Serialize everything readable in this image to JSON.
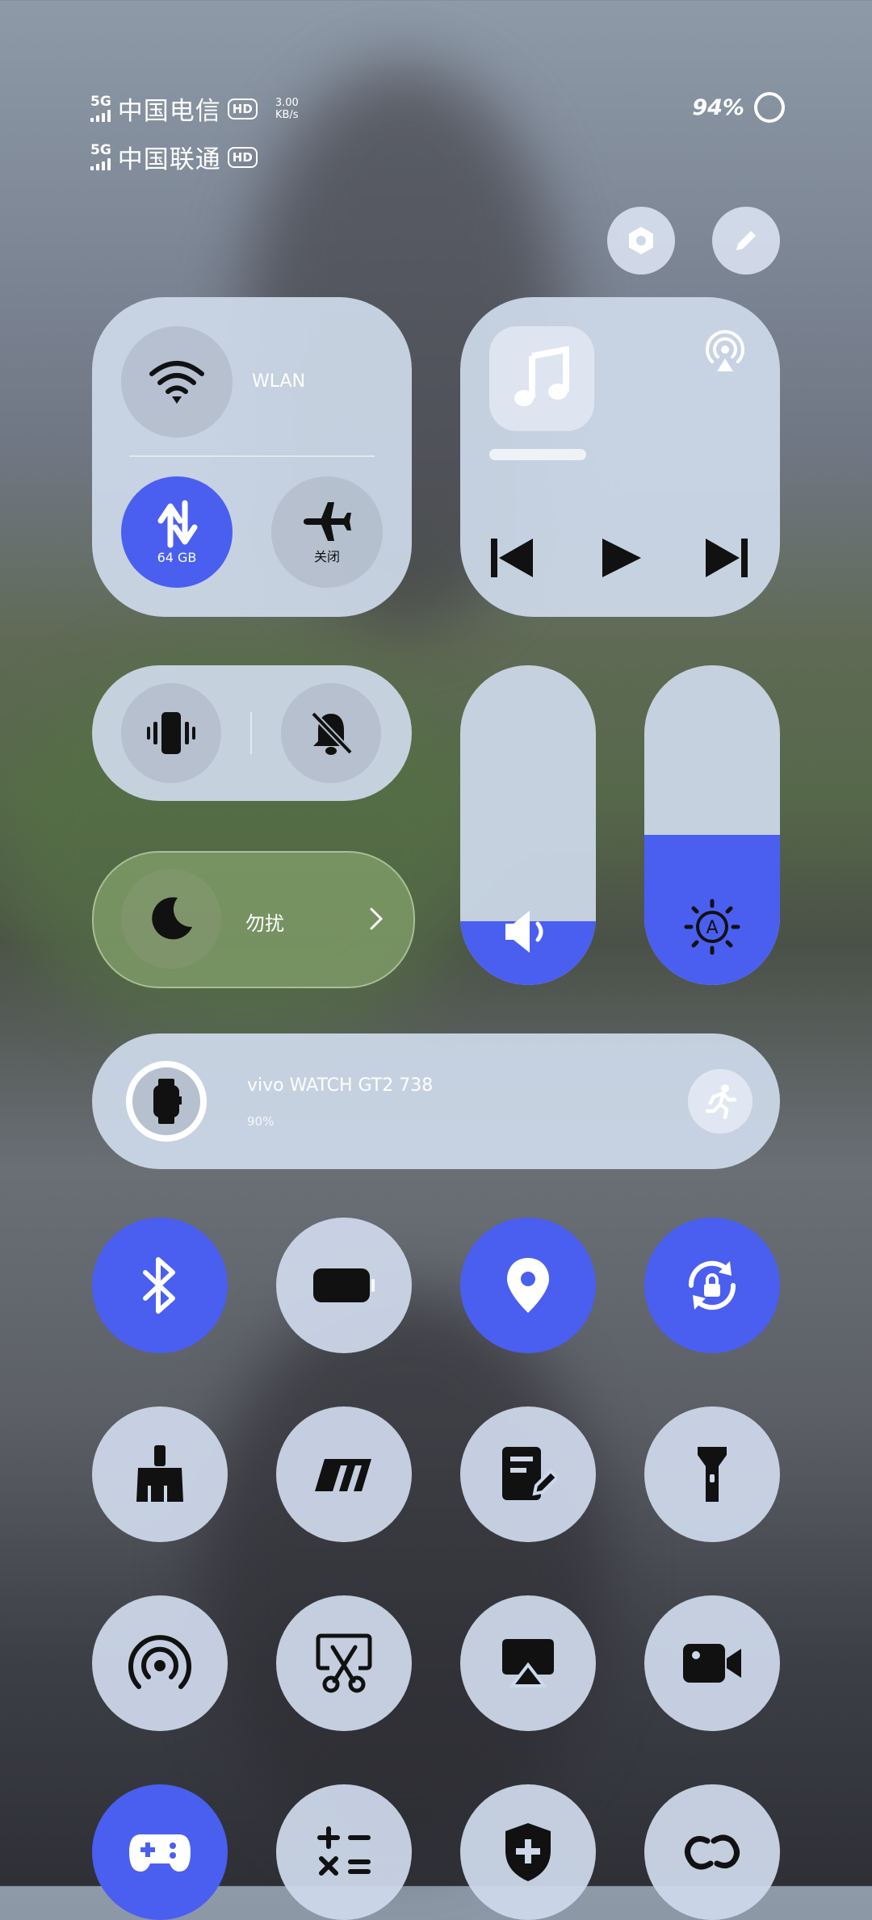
{
  "status_bar": {
    "carrier1": {
      "network": "5G",
      "name": "中国电信",
      "hd": "HD",
      "speed_value": "3.00",
      "speed_unit": "KB/s"
    },
    "carrier2": {
      "network": "5G",
      "name": "中国联通",
      "hd": "HD"
    },
    "battery_percent": "94%"
  },
  "connectivity": {
    "wifi_label": "WLAN",
    "data_usage": "64 GB",
    "airplane_label": "关闭"
  },
  "sound_modes": {},
  "dnd": {
    "label": "勿扰"
  },
  "sliders": {
    "volume_level": 0.2,
    "brightness_level": 0.47
  },
  "watch": {
    "name": "vivo WATCH GT2 738",
    "battery": "90%"
  },
  "tiles": [
    {
      "name": "bluetooth",
      "active": true
    },
    {
      "name": "battery-saver",
      "active": false
    },
    {
      "name": "location",
      "active": true
    },
    {
      "name": "rotation-lock",
      "active": true
    },
    {
      "name": "cleaner",
      "active": false
    },
    {
      "name": "m-logo",
      "active": false
    },
    {
      "name": "note",
      "active": false
    },
    {
      "name": "flashlight",
      "active": false
    },
    {
      "name": "hotspot",
      "active": false
    },
    {
      "name": "screenshot",
      "active": false
    },
    {
      "name": "screen-cast",
      "active": false
    },
    {
      "name": "screen-record",
      "active": false
    },
    {
      "name": "game-mode",
      "active": true
    },
    {
      "name": "calculator",
      "active": false
    },
    {
      "name": "security",
      "active": false
    },
    {
      "name": "link",
      "active": false
    }
  ],
  "colors": {
    "accent": "#4a5ff0",
    "tile": "#cdd8ea",
    "icon": "#111111"
  }
}
